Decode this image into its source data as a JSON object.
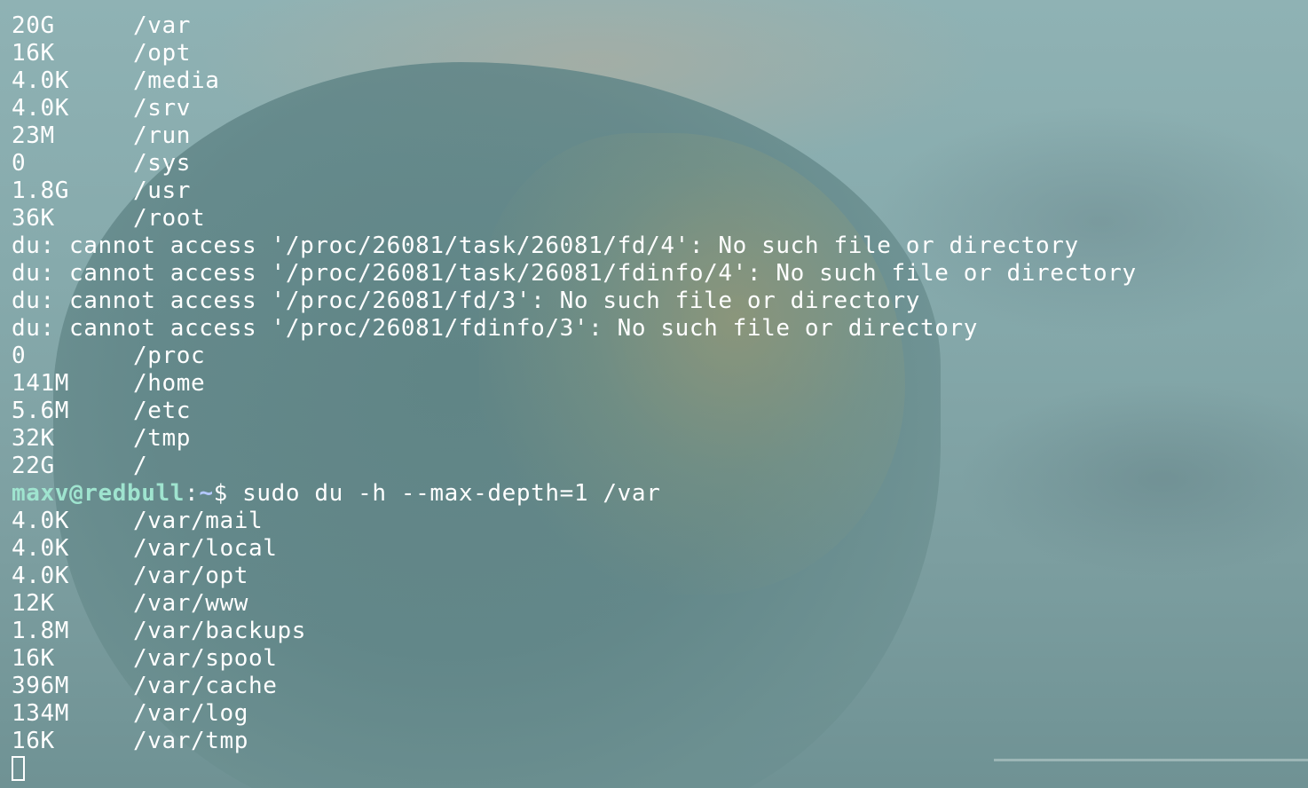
{
  "terminal": {
    "output_before": [
      {
        "size": "20G",
        "path": "/var"
      },
      {
        "size": "16K",
        "path": "/opt"
      },
      {
        "size": "4.0K",
        "path": "/media"
      },
      {
        "size": "4.0K",
        "path": "/srv"
      },
      {
        "size": "23M",
        "path": "/run"
      },
      {
        "size": "0",
        "path": "/sys"
      },
      {
        "size": "1.8G",
        "path": "/usr"
      },
      {
        "size": "36K",
        "path": "/root"
      }
    ],
    "errors": [
      "du: cannot access '/proc/26081/task/26081/fd/4': No such file or directory",
      "du: cannot access '/proc/26081/task/26081/fdinfo/4': No such file or directory",
      "du: cannot access '/proc/26081/fd/3': No such file or directory",
      "du: cannot access '/proc/26081/fdinfo/3': No such file or directory"
    ],
    "output_after": [
      {
        "size": "0",
        "path": "/proc"
      },
      {
        "size": "141M",
        "path": "/home"
      },
      {
        "size": "5.6M",
        "path": "/etc"
      },
      {
        "size": "32K",
        "path": "/tmp"
      },
      {
        "size": "22G",
        "path": "/"
      }
    ],
    "prompt": {
      "user_host": "maxv@redbull",
      "separator": ":",
      "path": "~",
      "symbol": "$",
      "command": " sudo du -h --max-depth=1 /var"
    },
    "var_output": [
      {
        "size": "4.0K",
        "path": "/var/mail"
      },
      {
        "size": "4.0K",
        "path": "/var/local"
      },
      {
        "size": "4.0K",
        "path": "/var/opt"
      },
      {
        "size": "12K",
        "path": "/var/www"
      },
      {
        "size": "1.8M",
        "path": "/var/backups"
      },
      {
        "size": "16K",
        "path": "/var/spool"
      },
      {
        "size": "396M",
        "path": "/var/cache"
      },
      {
        "size": "134M",
        "path": "/var/log"
      },
      {
        "size": "16K",
        "path": "/var/tmp"
      }
    ]
  },
  "colors": {
    "text": "#ffffff",
    "prompt_user": "#9fe4cf",
    "prompt_path": "#b4c8ff"
  }
}
